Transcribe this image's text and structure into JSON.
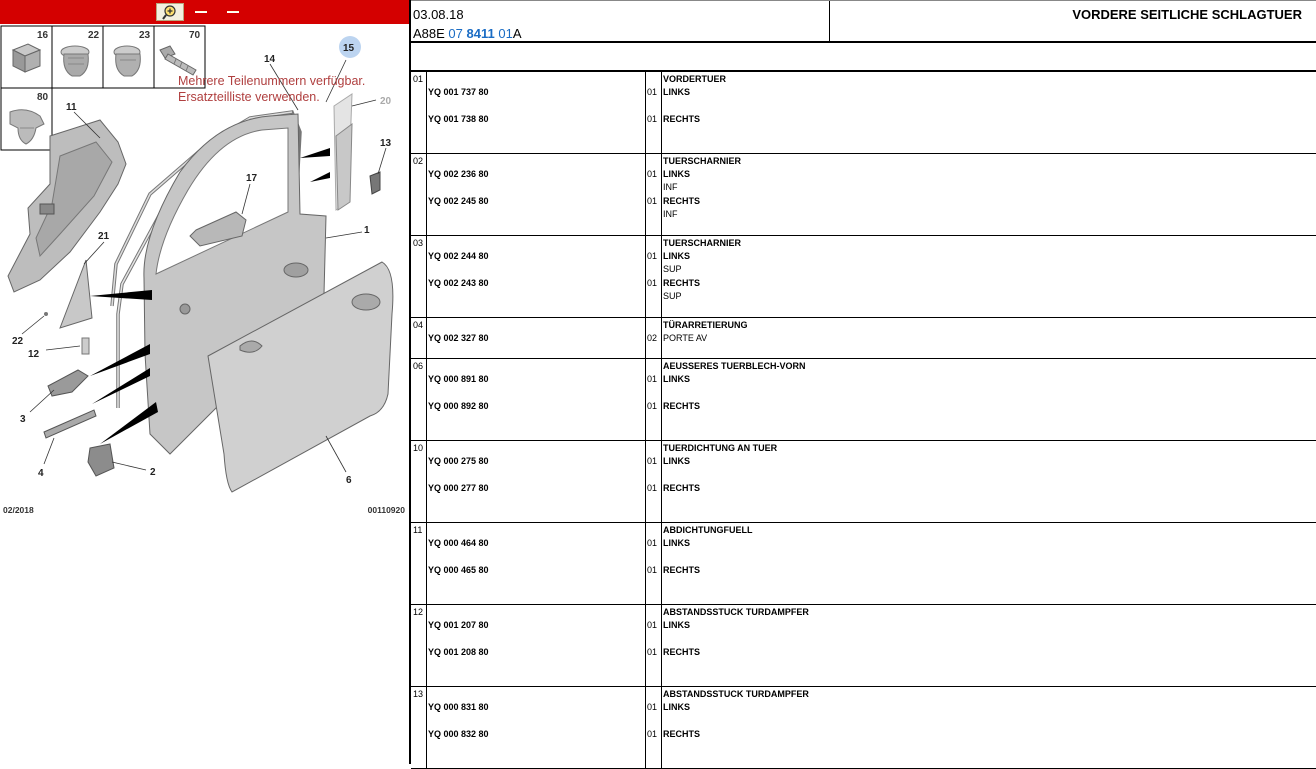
{
  "toolbar": {
    "buttons": [
      "zoom-icon",
      "tool-2",
      "tool-3"
    ]
  },
  "thumbnails": [
    {
      "label": "16",
      "icon": "cube-part-icon"
    },
    {
      "label": "22",
      "icon": "clip-part-icon"
    },
    {
      "label": "23",
      "icon": "clip-part-icon"
    },
    {
      "label": "70",
      "icon": "screw-part-icon"
    },
    {
      "label": "80",
      "icon": "rivet-part-icon"
    }
  ],
  "diagram": {
    "notice_line1": "Mehrere Teilenummern verfügbar.",
    "notice_line2": "Ersatzteilliste verwenden.",
    "callouts": [
      "14",
      "15",
      "20",
      "11",
      "13",
      "17",
      "21",
      "1",
      "22",
      "12",
      "3",
      "4",
      "2",
      "6"
    ],
    "date": "02/2018",
    "ref": "00110920"
  },
  "header": {
    "date": "03.08.18",
    "code_prefix": "A88E ",
    "code_a": "07",
    "code_b": "8411",
    "code_c": "01",
    "code_suffix": "A",
    "title": "VORDERE SEITLICHE SCHLAGTUER"
  },
  "parts": [
    {
      "num": "01",
      "title": "VORDERTUER",
      "items": [
        {
          "pn": "YQ 001 737 80",
          "qty": "01",
          "desc": "LINKS",
          "note": ""
        },
        {
          "pn": "YQ 001 738 80",
          "qty": "01",
          "desc": "RECHTS",
          "note": ""
        }
      ]
    },
    {
      "num": "02",
      "title": "TUERSCHARNIER",
      "items": [
        {
          "pn": "YQ 002 236 80",
          "qty": "01",
          "desc": "LINKS",
          "note": "INF"
        },
        {
          "pn": "YQ 002 245 80",
          "qty": "01",
          "desc": "RECHTS",
          "note": "INF"
        }
      ]
    },
    {
      "num": "03",
      "title": "TUERSCHARNIER",
      "items": [
        {
          "pn": "YQ 002 244 80",
          "qty": "01",
          "desc": "LINKS",
          "note": "SUP"
        },
        {
          "pn": "YQ 002 243 80",
          "qty": "01",
          "desc": "RECHTS",
          "note": "SUP"
        }
      ]
    },
    {
      "num": "04",
      "title": "TÜRARRETIERUNG",
      "items": [
        {
          "pn": "YQ 002 327 80",
          "qty": "02",
          "desc": "PORTE AV",
          "note": "",
          "plain": true
        }
      ]
    },
    {
      "num": "06",
      "title": "AEUSSERES TUERBLECH-VORN",
      "items": [
        {
          "pn": "YQ 000 891 80",
          "qty": "01",
          "desc": "LINKS",
          "note": ""
        },
        {
          "pn": "YQ 000 892 80",
          "qty": "01",
          "desc": "RECHTS",
          "note": ""
        }
      ]
    },
    {
      "num": "10",
      "title": "TUERDICHTUNG AN TUER",
      "items": [
        {
          "pn": "YQ 000 275 80",
          "qty": "01",
          "desc": "LINKS",
          "note": ""
        },
        {
          "pn": "YQ 000 277 80",
          "qty": "01",
          "desc": "RECHTS",
          "note": ""
        }
      ]
    },
    {
      "num": "11",
      "title": "ABDICHTUNGFUELL",
      "items": [
        {
          "pn": "YQ 000 464 80",
          "qty": "01",
          "desc": "LINKS",
          "note": ""
        },
        {
          "pn": "YQ 000 465 80",
          "qty": "01",
          "desc": "RECHTS",
          "note": ""
        }
      ]
    },
    {
      "num": "12",
      "title": "ABSTANDSSTUCK TURDAMPFER",
      "items": [
        {
          "pn": "YQ 001 207 80",
          "qty": "01",
          "desc": "LINKS",
          "note": ""
        },
        {
          "pn": "YQ 001 208 80",
          "qty": "01",
          "desc": "RECHTS",
          "note": ""
        }
      ]
    },
    {
      "num": "13",
      "title": "ABSTANDSSTUCK TURDAMPFER",
      "items": [
        {
          "pn": "YQ 000 831 80",
          "qty": "01",
          "desc": "LINKS",
          "note": ""
        },
        {
          "pn": "YQ 000 832 80",
          "qty": "01",
          "desc": "RECHTS",
          "note": ""
        }
      ]
    }
  ]
}
